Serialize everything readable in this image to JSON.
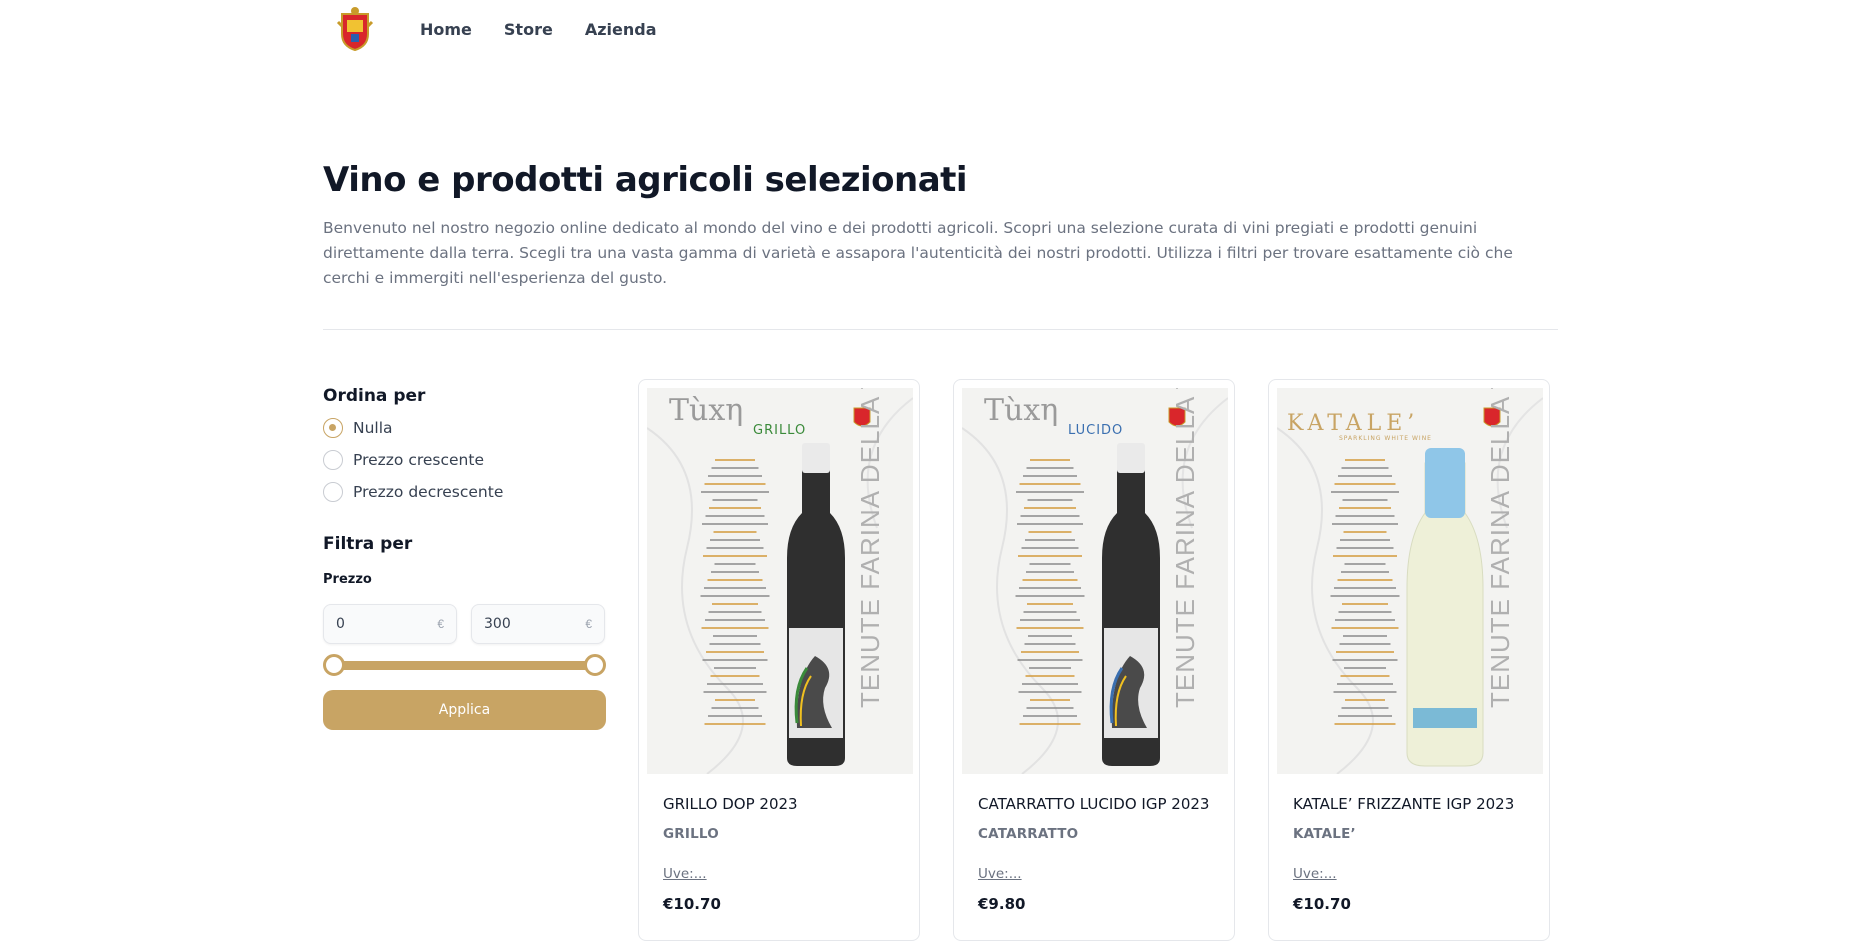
{
  "header": {
    "logo_name": "crest-logo",
    "nav": [
      {
        "label": "Home"
      },
      {
        "label": "Store"
      },
      {
        "label": "Azienda"
      }
    ]
  },
  "hero": {
    "title": "Vino e prodotti agricoli selezionati",
    "description": "Benvenuto nel nostro negozio online dedicato al mondo del vino e dei prodotti agricoli. Scopri una selezione curata di vini pregiati e prodotti genuini direttamente dalla terra. Scegli tra una vasta gamma di varietà e assapora l'autenticità dei nostri prodotti. Utilizza i filtri per trovare esattamente ciò che cerchi e immergiti nell'esperienza del gusto."
  },
  "sort": {
    "heading": "Ordina per",
    "selected_index": 0,
    "options": [
      {
        "label": "Nulla"
      },
      {
        "label": "Prezzo crescente"
      },
      {
        "label": "Prezzo decrescente"
      }
    ]
  },
  "filter": {
    "heading": "Filtra per",
    "price_label": "Prezzo",
    "min_value": "0",
    "max_value": "300",
    "currency": "€",
    "apply_label": "Applica"
  },
  "products": [
    {
      "name": "GRILLO DOP 2023",
      "variety": "GRILLO",
      "uve": "Uve:...",
      "price": "€10.70",
      "label_brand": "Tùxη",
      "label_type": "GRILLO",
      "label_type_color": "#3a8a3a",
      "vertical_text": "TENUTE FARINA DELLA TORRE",
      "bottle": "dark"
    },
    {
      "name": "CATARRATTO LUCIDO IGP 2023",
      "variety": "CATARRATTO",
      "uve": "Uve:...",
      "price": "€9.80",
      "label_brand": "Tùxη",
      "label_type": "LUCIDO",
      "label_type_color": "#3a6fb0",
      "vertical_text": "TENUTE FARINA DELLA TORRE",
      "bottle": "dark"
    },
    {
      "name": "KATALE’ FRIZZANTE IGP 2023",
      "variety": "KATALE’",
      "uve": "Uve:...",
      "price": "€10.70",
      "label_brand": "KATALE’",
      "label_type": "SPARKLING WHITE WINE",
      "label_type_color": "#c8a464",
      "vertical_text": "TENUTE FARINA DELLA TORRE",
      "bottle": "clear"
    }
  ]
}
